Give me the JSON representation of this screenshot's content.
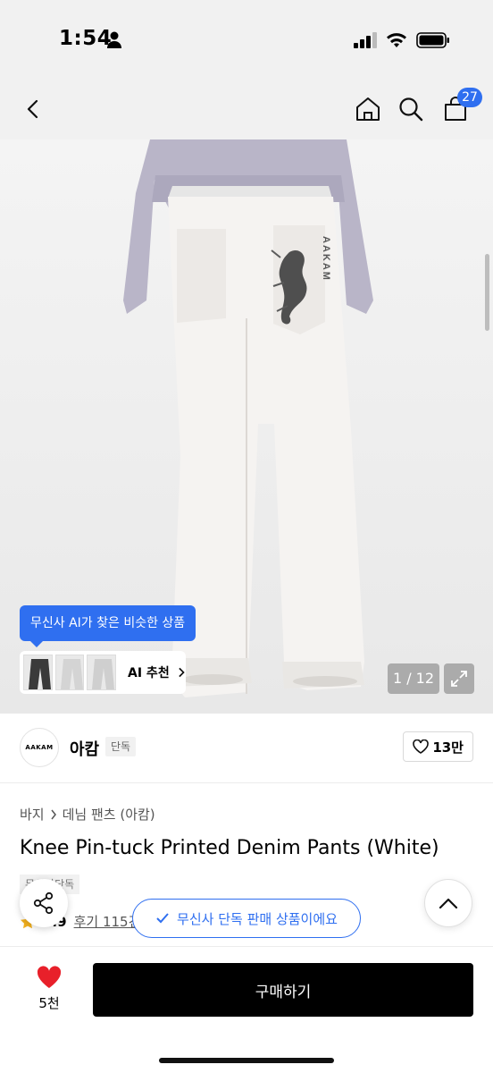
{
  "status": {
    "time": "1:54"
  },
  "nav": {
    "cart_count": "27"
  },
  "gallery": {
    "counter": "1 / 12",
    "print_text": "AAKAM",
    "ai_tooltip": "무신사 AI가 찾은 비슷한 상품",
    "ai_label": "AI 추천"
  },
  "brand": {
    "logo_text": "AAKAM",
    "name": "아캄",
    "tag": "단독",
    "likes": "13만"
  },
  "product": {
    "breadcrumb": [
      "바지",
      "데님 팬츠 (아캄)"
    ],
    "title": "Knee Pin-tuck Printed Denim Pants (White)",
    "exclusive_tag": "무신사단독",
    "rating": "4.9",
    "reviews": "후기 115건"
  },
  "toast": {
    "text": "무신사 단독 판매 상품이에요"
  },
  "bottom": {
    "wish_count": "5천",
    "buy_label": "구매하기"
  },
  "colors": {
    "accent": "#2f6ff0",
    "heart": "#e8202a",
    "buy_bg": "#000000"
  }
}
